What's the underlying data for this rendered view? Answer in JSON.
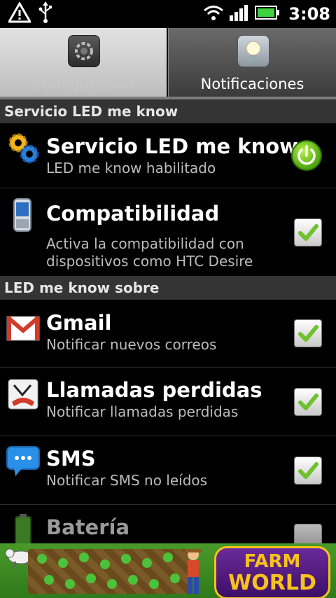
{
  "status_bar": {
    "time": "3:08",
    "icons": [
      "warning-icon",
      "usb-icon",
      "wifi-icon",
      "signal-icon",
      "battery-icon"
    ]
  },
  "tabs": [
    {
      "label": "Configuración",
      "icon": "settings-gear-icon",
      "selected": false
    },
    {
      "label": "Notificaciones",
      "icon": "lightbulb-icon",
      "selected": true
    }
  ],
  "sections": {
    "service": "Servicio LED me know",
    "notify": "LED me know sobre"
  },
  "rows": {
    "service": {
      "title": "Servicio LED me know",
      "subtitle": "LED me know habilitado",
      "icon": "gears-icon",
      "control": "power-toggle"
    },
    "compat": {
      "title": "Compatibilidad",
      "subtitle": "Activa la compatibilidad con dispositivos como HTC Desire",
      "icon": "phone-icon",
      "checked": true
    },
    "gmail": {
      "title": "Gmail",
      "subtitle": "Notificar nuevos correos",
      "icon": "gmail-icon",
      "checked": true
    },
    "calls": {
      "title": "Llamadas perdidas",
      "subtitle": "Notificar llamadas perdidas",
      "icon": "missed-call-icon",
      "checked": true
    },
    "sms": {
      "title": "SMS",
      "subtitle": "Notificar SMS no leídos",
      "icon": "sms-bubble-icon",
      "checked": true
    },
    "battery": {
      "title": "Batería",
      "icon": "battery-status-icon"
    }
  },
  "ad": {
    "brand_line1": "FARM",
    "brand_line2": "WORLD"
  },
  "colors": {
    "check_mark": "#6fc12f",
    "power_green": "#4ea60f",
    "section_bg": "#343434"
  }
}
